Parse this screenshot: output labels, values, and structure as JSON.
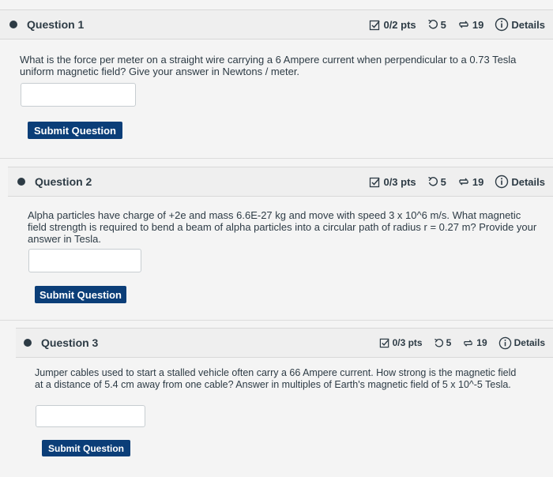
{
  "questions": [
    {
      "title": "Question 1",
      "points": "0/2 pts",
      "attempts": "5",
      "retries": "19",
      "details": "Details",
      "text": "What is the force per meter on a straight wire carrying a 6 Ampere current when perpendicular to a 0.73 Tesla uniform magnetic field? Give your answer in Newtons / meter.",
      "submit": "Submit Question"
    },
    {
      "title": "Question 2",
      "points": "0/3 pts",
      "attempts": "5",
      "retries": "19",
      "details": "Details",
      "text": "Alpha particles have charge of +2e and mass 6.6E-27 kg and move with speed 3 x 10^6 m/s. What magnetic field strength is required to bend a beam of alpha particles into a circular path of radius r = 0.27 m? Provide your answer in Tesla.",
      "submit": "Submit Question"
    },
    {
      "title": "Question 3",
      "points": "0/3 pts",
      "attempts": "5",
      "retries": "19",
      "details": "Details",
      "text": "Jumper cables used to start a stalled vehicle often carry a 66 Ampere current. How strong is the magnetic field at a distance of 5.4 cm away from one cable? Answer in multiples of Earth's magnetic field of 5 x 10^-5 Tesla.",
      "submit": "Submit Question"
    }
  ]
}
